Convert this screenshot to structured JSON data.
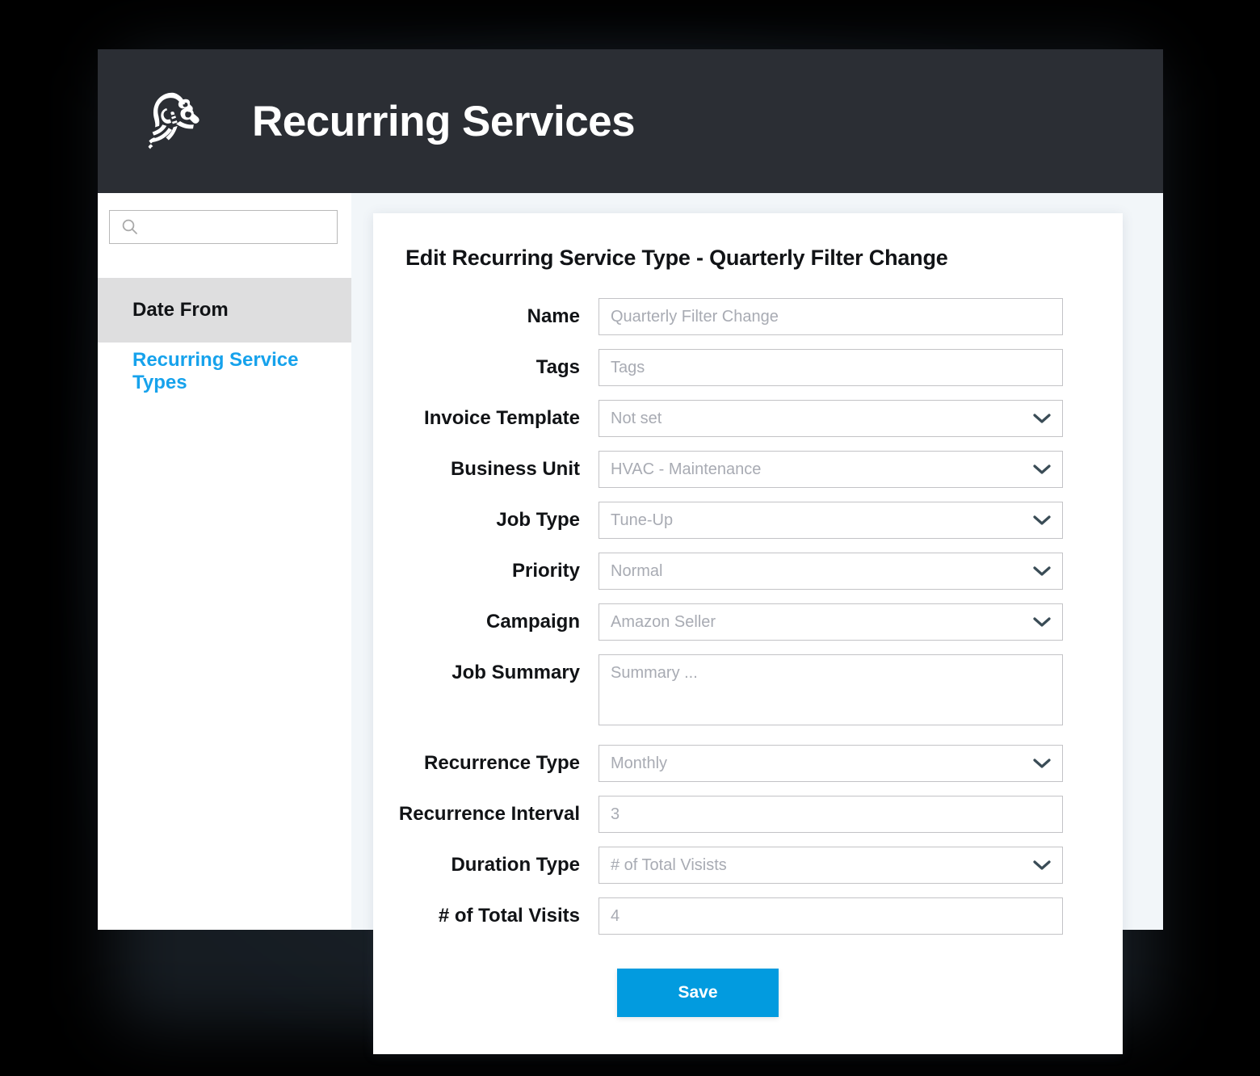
{
  "header": {
    "title": "Recurring Services",
    "logo_icon": "mascot-logo-icon",
    "background_color": "#2B2E34"
  },
  "sidebar": {
    "search": {
      "value": "",
      "placeholder": "",
      "icon": "search-icon"
    },
    "items": [
      {
        "label": "Date From",
        "active": true
      },
      {
        "label": "Recurring Service Types",
        "active": false,
        "link": true
      }
    ]
  },
  "form": {
    "title": "Edit Recurring Service Type - Quarterly Filter Change",
    "fields": {
      "name": {
        "label": "Name",
        "placeholder": "Quarterly Filter Change",
        "value": ""
      },
      "tags": {
        "label": "Tags",
        "placeholder": "Tags",
        "value": ""
      },
      "invoice_template": {
        "label": "Invoice Template",
        "value": "Not set"
      },
      "business_unit": {
        "label": "Business Unit",
        "value": "HVAC - Maintenance"
      },
      "job_type": {
        "label": "Job Type",
        "value": "Tune-Up"
      },
      "priority": {
        "label": "Priority",
        "value": "Normal"
      },
      "campaign": {
        "label": "Campaign",
        "value": "Amazon Seller"
      },
      "job_summary": {
        "label": "Job Summary",
        "placeholder": "Summary ...",
        "value": ""
      },
      "recurrence_type": {
        "label": "Recurrence Type",
        "value": "Monthly"
      },
      "recurrence_interval": {
        "label": "Recurrence Interval",
        "placeholder": "3",
        "value": ""
      },
      "duration_type": {
        "label": "Duration Type",
        "value": "# of Total Visists"
      },
      "total_visits": {
        "label": "# of Total Visits",
        "placeholder": "4",
        "value": ""
      }
    },
    "save_label": "Save",
    "accent_color": "#029BDF"
  },
  "colors": {
    "accent_blue": "#16A2EC",
    "save_blue": "#029BDF",
    "header_dark": "#2B2E34",
    "sidebar_active": "#DEDEDF",
    "page_background": "#F2F6F9"
  }
}
